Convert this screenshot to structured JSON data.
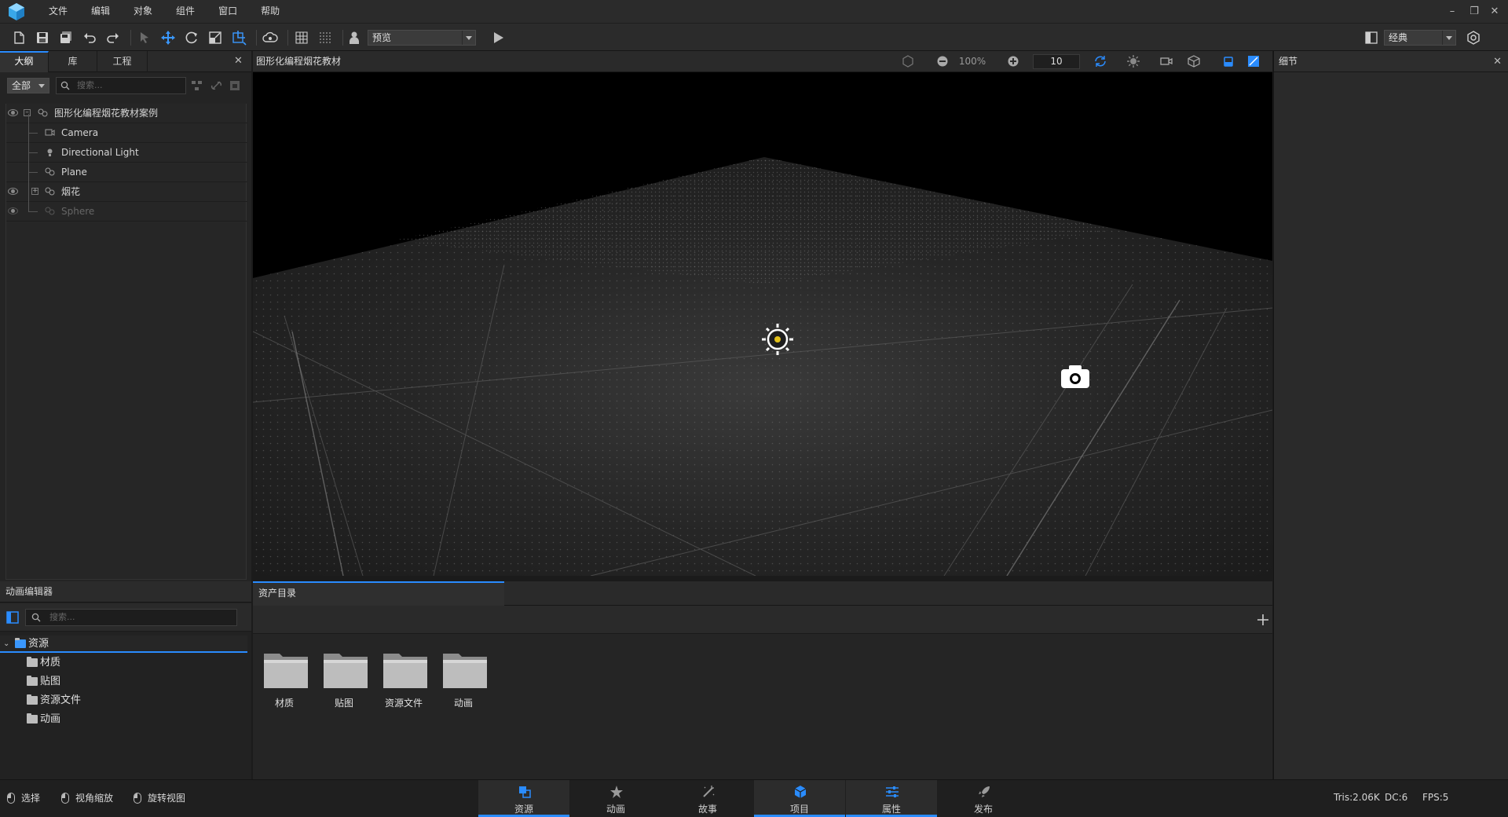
{
  "menu": {
    "items": [
      "文件",
      "编辑",
      "对象",
      "组件",
      "窗口",
      "帮助"
    ]
  },
  "toolbar": {
    "preview_combo": "预览",
    "layout_combo": "经典"
  },
  "outline": {
    "tabs": [
      "大纲",
      "库",
      "工程"
    ],
    "filter": "全部",
    "search_placeholder": "搜索...",
    "tree": [
      {
        "label": "图形化编程烟花教材案例",
        "icon": "group-icon"
      },
      {
        "label": "Camera",
        "icon": "camera-icon"
      },
      {
        "label": "Directional Light",
        "icon": "light-icon"
      },
      {
        "label": "Plane",
        "icon": "mesh-icon"
      },
      {
        "label": "烟花",
        "icon": "mesh-icon"
      },
      {
        "label": "Sphere",
        "icon": "mesh-icon"
      }
    ]
  },
  "viewport": {
    "title": "图形化编程烟花教材",
    "zoom": "100%",
    "grid_size": "10"
  },
  "details": {
    "title": "细节"
  },
  "anim_editor": {
    "title": "动画编辑器",
    "search_placeholder": "搜索...",
    "tree_root": "资源",
    "tree_children": [
      "材质",
      "贴图",
      "资源文件",
      "动画"
    ]
  },
  "assets": {
    "tab": "资产目录",
    "folders": [
      "材质",
      "贴图",
      "资源文件",
      "动画"
    ]
  },
  "statusbar": {
    "hints": [
      "选择",
      "视角缩放",
      "旋转视图"
    ],
    "nav_tabs": [
      "资源",
      "动画",
      "故事",
      "项目",
      "属性",
      "发布"
    ],
    "stats": {
      "tris": "Tris:2.06K",
      "dc": "DC:6",
      "fps": "FPS:5"
    }
  },
  "colors": {
    "accent": "#2a8cff",
    "panel": "#242424",
    "header": "#2b2b2b"
  }
}
